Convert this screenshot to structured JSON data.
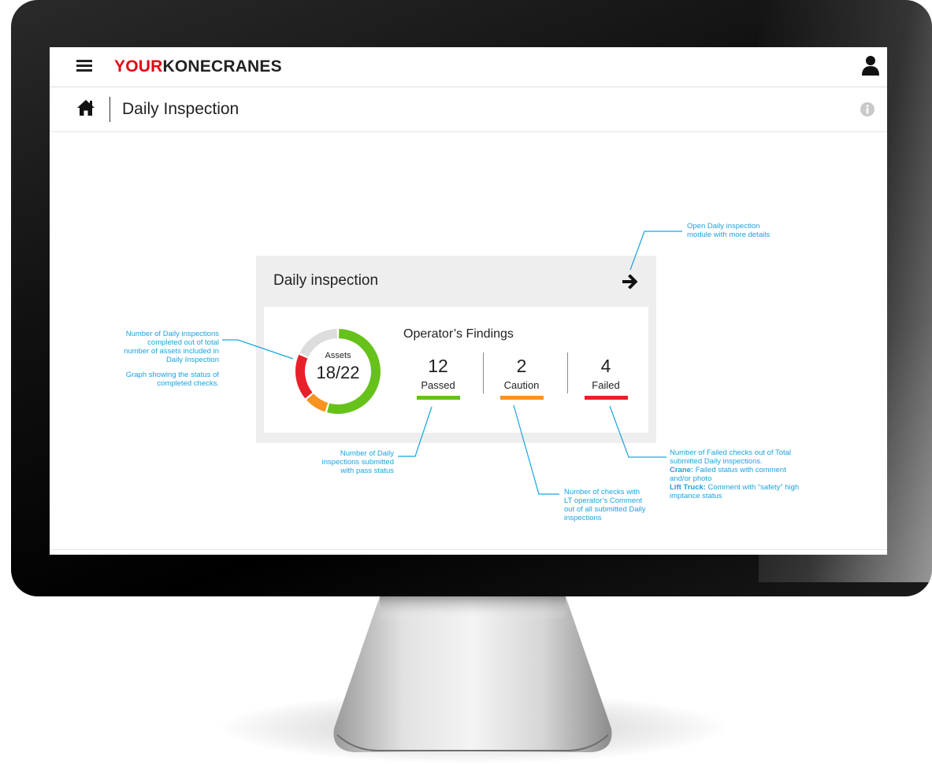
{
  "header": {
    "logo_part1": "YOUR",
    "logo_part2": "KONECRANES",
    "page_title": "Daily Inspection"
  },
  "widget": {
    "title": "Daily inspection",
    "donut": {
      "label": "Assets",
      "value": "18/22",
      "segments": [
        {
          "status": "passed",
          "color": "#66c21a"
        },
        {
          "status": "caution",
          "color": "#f7931e"
        },
        {
          "status": "failed",
          "color": "#e8202a"
        },
        {
          "status": "remaining",
          "color": "#dddddd"
        }
      ]
    },
    "findings_title": "Operator’s Findings",
    "metrics": [
      {
        "value": "12",
        "label": "Passed",
        "color": "#66c21a"
      },
      {
        "value": "2",
        "label": "Caution",
        "color": "#f7931e"
      },
      {
        "value": "4",
        "label": "Failed",
        "color": "#e8202a"
      }
    ]
  },
  "annotations": {
    "donut_note_1": [
      "Number of Daily inspections",
      "completed out of total",
      "number of assets included in",
      "Daily Inspection"
    ],
    "donut_note_2": [
      "Graph showing the status of",
      "completed checks."
    ],
    "arrow_note": [
      "Open Daily inspection",
      "module with more details"
    ],
    "passed_note": [
      "Number of Daily",
      "inspections submitted",
      "with pass status"
    ],
    "caution_note": [
      "Number of checks with",
      "LT operator’s Comment",
      "out of all submitted Daily",
      "inspections"
    ],
    "failed_note": {
      "line1": "Number of Failed checks out of Total",
      "line2": "submitted Daily inspections.",
      "crane_label": "Crane:",
      "crane_text": " Failed status with comment",
      "line4": "and/or photo",
      "lift_label": "Lift Truck:",
      "lift_text": " Comment with “safety” high",
      "line6": "imptance status"
    }
  },
  "icons": {
    "menu": "hamburger-menu-icon",
    "user": "user-icon",
    "home": "home-icon",
    "info": "info-icon",
    "arrow": "arrow-right-icon"
  }
}
